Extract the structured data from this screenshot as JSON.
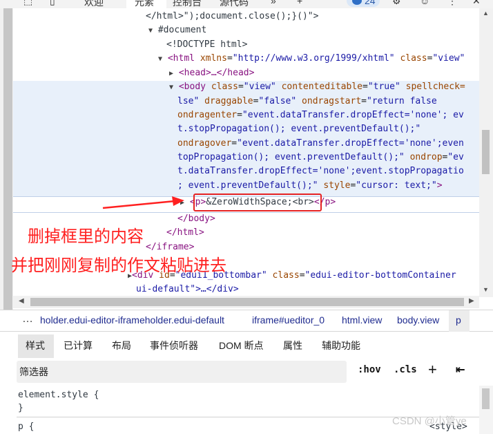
{
  "toolbar": {
    "welcome_tab": "欢迎",
    "elements_tab": "元素",
    "console_tab": "控制台",
    "sources_tab": "源代码",
    "more_tabs": "»",
    "add_tab": "+",
    "issues_count": "24"
  },
  "dom": {
    "line_html_close": "</html>\");document.close();}()\">",
    "line_document": "#document",
    "line_doctype": "<!DOCTYPE html>",
    "html_tag_open": "<html",
    "html_xmlns_attr": "xmlns",
    "html_xmlns_val": "\"http://www.w3.org/1999/xhtml\"",
    "html_class_attr": "class",
    "html_class_val": "\"view\"",
    "head_line": "<head>…</head>",
    "body_tag": "<body",
    "body_class_attr": "class",
    "body_class_val": "\"view\"",
    "body_ce_attr": "contenteditable",
    "body_ce_val": "\"true\"",
    "body_spell_attr": "spellcheck=",
    "body_l2_val": "lse\"",
    "body_l2_drag_attr": "draggable",
    "body_l2_drag_val": "\"false\"",
    "body_l2_ods_attr": "ondragstart",
    "body_l2_ods_val": "\"return false",
    "body_l3_attr": "ondragenter",
    "body_l3_val": "\"event.dataTransfer.dropEffect='none'; ev",
    "body_l4_val": "t.stopPropagation(); event.preventDefault();\"",
    "body_l5_attr": "ondragover",
    "body_l5_val": "\"event.dataTransfer.dropEffect='none';even",
    "body_l6_val": "topPropagation(); event.preventDefault();\"",
    "body_l6_attr": "ondrop",
    "body_l6_val2": "\"ev",
    "body_l7_val": "t.dataTransfer.dropEffect='none';event.stopPropagatio",
    "body_l8_val": "; event.preventDefault();\"",
    "body_l8_style_attr": "style",
    "body_l8_style_val": "\"cursor: text;\"",
    "body_l8_close": ">",
    "p_open": "<p>",
    "p_content": "&ZeroWidthSpace;<br>",
    "p_close": "</p>",
    "body_close": "</body>",
    "html_close": "</html>",
    "iframe_close": "</iframe>",
    "div_tag": "<div",
    "div_id_attr": "id",
    "div_id_val": "\"edui1_bottombar\"",
    "div_class_attr": "class",
    "div_class_val": "\"edui-editor-bottomContainer",
    "div_line2": "ui-default\">…</div>"
  },
  "breadcrumb": {
    "more": "…",
    "items": [
      "holder.edui-editor-iframeholder.edui-default",
      "iframe#ueditor_0",
      "html.view",
      "body.view",
      "p"
    ]
  },
  "styles_tabs": [
    "样式",
    "已计算",
    "布局",
    "事件侦听器",
    "DOM 断点",
    "属性",
    "辅助功能"
  ],
  "filter": {
    "placeholder": "筛选器",
    "hov": ":hov",
    "cls": ".cls",
    "add": "+"
  },
  "rules": {
    "element_style_open": "element.style {",
    "element_style_close": "}",
    "p_selector": "p {",
    "p_source": "<style>"
  },
  "annotations": {
    "line1": "删掉框里的内容",
    "line2": "并把刚刚复制的作文粘贴进去"
  },
  "watermark": "CSDN @小管ye",
  "colors": {
    "annotation_red": "#ff2020",
    "tag_purple": "#881280",
    "attr_brown": "#994500",
    "value_blue": "#1a1aa6"
  }
}
